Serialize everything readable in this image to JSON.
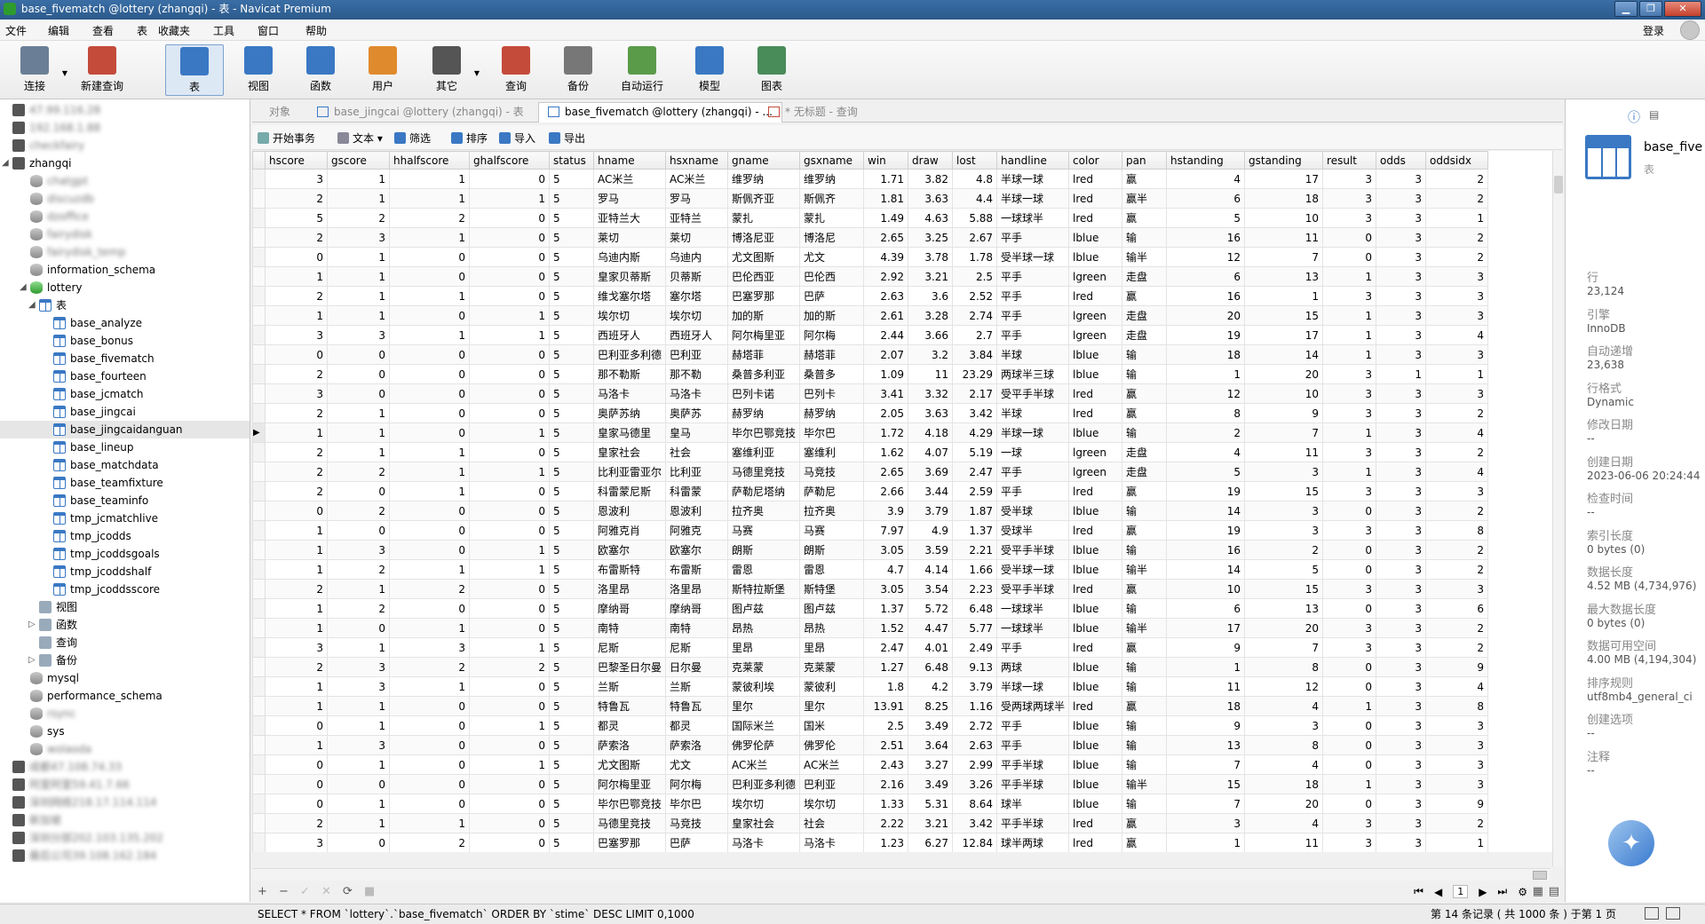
{
  "window": {
    "title": "base_fivematch @lottery (zhangqi) - 表 - Navicat Premium",
    "min": "▁",
    "max": "❐",
    "close": "✕"
  },
  "menu": [
    "文件",
    "编辑",
    "查看",
    "表",
    "收藏夹",
    "工具",
    "窗口",
    "帮助"
  ],
  "login": "登录",
  "toolbar": [
    {
      "label": "连接",
      "icon": "plug-icon",
      "color": "#6a7f95"
    },
    {
      "label": "新建查询",
      "icon": "new-query-icon",
      "color": "#c44b3a"
    },
    {
      "label": "表",
      "icon": "table-icon",
      "color": "#3a78c4"
    },
    {
      "label": "视图",
      "icon": "view-icon",
      "color": "#3a78c4"
    },
    {
      "label": "函数",
      "icon": "function-icon",
      "color": "#3a78c4"
    },
    {
      "label": "用户",
      "icon": "user-icon",
      "color": "#e08a2e"
    },
    {
      "label": "其它",
      "icon": "tools-icon",
      "color": "#555"
    },
    {
      "label": "查询",
      "icon": "query-icon",
      "color": "#c44b3a"
    },
    {
      "label": "备份",
      "icon": "backup-icon",
      "color": "#777"
    },
    {
      "label": "自动运行",
      "icon": "schedule-icon",
      "color": "#5a9b4a"
    },
    {
      "label": "模型",
      "icon": "model-icon",
      "color": "#3a78c4"
    },
    {
      "label": "图表",
      "icon": "chart-icon",
      "color": "#4a8b5a"
    }
  ],
  "tree": [
    {
      "label": "47.99.116.28",
      "icon": "conn",
      "blur": true
    },
    {
      "label": "192.168.1.88",
      "icon": "conn",
      "blur": true
    },
    {
      "label": "checkfairy",
      "icon": "conn",
      "blur": true
    },
    {
      "label": "zhangqi",
      "icon": "conn",
      "toggle": "◢"
    },
    {
      "label": "chatgpt",
      "icon": "db",
      "blur": true
    },
    {
      "label": "discuzdb",
      "icon": "db",
      "blur": true
    },
    {
      "label": "dzoffice",
      "icon": "db",
      "blur": true
    },
    {
      "label": "fairydisk",
      "icon": "db",
      "blur": true
    },
    {
      "label": "fairydisk_temp",
      "icon": "db",
      "blur": true
    },
    {
      "label": "information_schema",
      "icon": "db"
    },
    {
      "label": "lottery",
      "icon": "dbg",
      "toggle": "◢"
    },
    {
      "label": "表",
      "icon": "tbl",
      "toggle": "◢"
    },
    {
      "label": "base_analyze",
      "icon": "tbl"
    },
    {
      "label": "base_bonus",
      "icon": "tbl"
    },
    {
      "label": "base_fivematch",
      "icon": "tbl"
    },
    {
      "label": "base_fourteen",
      "icon": "tbl"
    },
    {
      "label": "base_jcmatch",
      "icon": "tbl"
    },
    {
      "label": "base_jingcai",
      "icon": "tbl"
    },
    {
      "label": "base_jingcaidanguan",
      "icon": "tbl",
      "selected": true
    },
    {
      "label": "base_lineup",
      "icon": "tbl"
    },
    {
      "label": "base_matchdata",
      "icon": "tbl"
    },
    {
      "label": "base_teamfixture",
      "icon": "tbl"
    },
    {
      "label": "base_teaminfo",
      "icon": "tbl"
    },
    {
      "label": "tmp_jcmatchlive",
      "icon": "tbl"
    },
    {
      "label": "tmp_jcodds",
      "icon": "tbl"
    },
    {
      "label": "tmp_jcoddsgoals",
      "icon": "tbl"
    },
    {
      "label": "tmp_jcoddshalf",
      "icon": "tbl"
    },
    {
      "label": "tmp_jcoddsscore",
      "icon": "tbl"
    },
    {
      "label": "视图",
      "icon": "misc"
    },
    {
      "label": "函数",
      "icon": "misc",
      "toggle": "▷"
    },
    {
      "label": "查询",
      "icon": "misc"
    },
    {
      "label": "备份",
      "icon": "misc",
      "toggle": "▷"
    },
    {
      "label": "mysql",
      "icon": "db"
    },
    {
      "label": "performance_schema",
      "icon": "db"
    },
    {
      "label": "rsync",
      "icon": "db",
      "blur": true
    },
    {
      "label": "sys",
      "icon": "db"
    },
    {
      "label": "wolaoda",
      "icon": "db",
      "blur": true
    },
    {
      "label": "成都47.108.74.33",
      "icon": "conn",
      "blur": true
    },
    {
      "label": "阿里阿里59.41.7.66",
      "icon": "conn",
      "blur": true
    },
    {
      "label": "深圳网络218.17.114.114",
      "icon": "conn",
      "blur": true
    },
    {
      "label": "新加坡",
      "icon": "conn",
      "blur": true
    },
    {
      "label": "深圳分部202.103.135.202",
      "icon": "conn",
      "blur": true
    },
    {
      "label": "最后公司39.108.162.184",
      "icon": "conn",
      "blur": true
    }
  ],
  "tabs": [
    {
      "label": "对象",
      "active": false
    },
    {
      "label": "base_jingcai @lottery (zhangqi) - 表",
      "active": false
    },
    {
      "label": "base_fivematch @lottery (zhangqi) - ...",
      "active": true
    },
    {
      "label": "* 无标题 - 查询",
      "active": false
    }
  ],
  "subtoolbar": [
    "开始事务",
    "文本",
    "筛选",
    "排序",
    "导入",
    "导出"
  ],
  "columns": [
    "hscore",
    "gscore",
    "hhalfscore",
    "ghalfscore",
    "status",
    "hname",
    "hsxname",
    "gname",
    "gsxname",
    "win",
    "draw",
    "lost",
    "handline",
    "color",
    "pan",
    "hstanding",
    "gstanding",
    "result",
    "odds",
    "oddsidx"
  ],
  "rows": [
    [
      "3",
      "1",
      "1",
      "0",
      "5",
      "AC米兰",
      "AC米兰",
      "维罗纳",
      "维罗纳",
      "1.71",
      "3.82",
      "4.8",
      "半球一球",
      "lred",
      "赢",
      "4",
      "17",
      "3",
      "3",
      "2"
    ],
    [
      "2",
      "1",
      "1",
      "1",
      "5",
      "罗马",
      "罗马",
      "斯佩齐亚",
      "斯佩齐",
      "1.81",
      "3.63",
      "4.4",
      "半球一球",
      "lred",
      "赢半",
      "6",
      "18",
      "3",
      "3",
      "2"
    ],
    [
      "5",
      "2",
      "2",
      "0",
      "5",
      "亚特兰大",
      "亚特兰",
      "蒙扎",
      "蒙扎",
      "1.49",
      "4.63",
      "5.88",
      "一球球半",
      "lred",
      "赢",
      "5",
      "10",
      "3",
      "3",
      "1"
    ],
    [
      "2",
      "3",
      "1",
      "0",
      "5",
      "莱切",
      "莱切",
      "博洛尼亚",
      "博洛尼",
      "2.65",
      "3.25",
      "2.67",
      "平手",
      "lblue",
      "输",
      "16",
      "11",
      "0",
      "3",
      "2"
    ],
    [
      "0",
      "1",
      "0",
      "0",
      "5",
      "乌迪内斯",
      "乌迪内",
      "尤文图斯",
      "尤文",
      "4.39",
      "3.78",
      "1.78",
      "受半球一球",
      "lblue",
      "输半",
      "12",
      "7",
      "0",
      "3",
      "2"
    ],
    [
      "1",
      "1",
      "0",
      "0",
      "5",
      "皇家贝蒂斯",
      "贝蒂斯",
      "巴伦西亚",
      "巴伦西",
      "2.92",
      "3.21",
      "2.5",
      "平手",
      "lgreen",
      "走盘",
      "6",
      "13",
      "1",
      "3",
      "3"
    ],
    [
      "2",
      "1",
      "1",
      "0",
      "5",
      "维戈塞尔塔",
      "塞尔塔",
      "巴塞罗那",
      "巴萨",
      "2.63",
      "3.6",
      "2.52",
      "平手",
      "lred",
      "赢",
      "16",
      "1",
      "3",
      "3",
      "3"
    ],
    [
      "1",
      "1",
      "0",
      "1",
      "5",
      "埃尔切",
      "埃尔切",
      "加的斯",
      "加的斯",
      "2.61",
      "3.28",
      "2.74",
      "平手",
      "lgreen",
      "走盘",
      "20",
      "15",
      "1",
      "3",
      "3"
    ],
    [
      "3",
      "3",
      "1",
      "1",
      "5",
      "西班牙人",
      "西班牙人",
      "阿尔梅里亚",
      "阿尔梅",
      "2.44",
      "3.66",
      "2.7",
      "平手",
      "lgreen",
      "走盘",
      "19",
      "17",
      "1",
      "3",
      "4"
    ],
    [
      "0",
      "0",
      "0",
      "0",
      "5",
      "巴利亚多利德",
      "巴利亚",
      "赫塔菲",
      "赫塔菲",
      "2.07",
      "3.2",
      "3.84",
      "半球",
      "lblue",
      "输",
      "18",
      "14",
      "1",
      "3",
      "3"
    ],
    [
      "2",
      "0",
      "0",
      "0",
      "5",
      "那不勒斯",
      "那不勒",
      "桑普多利亚",
      "桑普多",
      "1.09",
      "11",
      "23.29",
      "两球半三球",
      "lblue",
      "输",
      "1",
      "20",
      "3",
      "1",
      "1"
    ],
    [
      "3",
      "0",
      "0",
      "0",
      "5",
      "马洛卡",
      "马洛卡",
      "巴列卡诺",
      "巴列卡",
      "3.41",
      "3.32",
      "2.17",
      "受平手半球",
      "lred",
      "赢",
      "12",
      "10",
      "3",
      "3",
      "3"
    ],
    [
      "2",
      "1",
      "0",
      "0",
      "5",
      "奥萨苏纳",
      "奥萨苏",
      "赫罗纳",
      "赫罗纳",
      "2.05",
      "3.63",
      "3.42",
      "半球",
      "lred",
      "赢",
      "8",
      "9",
      "3",
      "3",
      "2"
    ],
    [
      "1",
      "1",
      "0",
      "1",
      "5",
      "皇家马德里",
      "皇马",
      "毕尔巴鄂竞技",
      "毕尔巴",
      "1.72",
      "4.18",
      "4.29",
      "半球一球",
      "lblue",
      "输",
      "2",
      "7",
      "1",
      "3",
      "4"
    ],
    [
      "2",
      "1",
      "1",
      "0",
      "5",
      "皇家社会",
      "社会",
      "塞维利亚",
      "塞维利",
      "1.62",
      "4.07",
      "5.19",
      "一球",
      "lgreen",
      "走盘",
      "4",
      "11",
      "3",
      "3",
      "2"
    ],
    [
      "2",
      "2",
      "1",
      "1",
      "5",
      "比利亚雷亚尔",
      "比利亚",
      "马德里竞技",
      "马竞技",
      "2.65",
      "3.69",
      "2.47",
      "平手",
      "lgreen",
      "走盘",
      "5",
      "3",
      "1",
      "3",
      "4"
    ],
    [
      "2",
      "0",
      "1",
      "0",
      "5",
      "科雷蒙尼斯",
      "科雷蒙",
      "萨勒尼塔纳",
      "萨勒尼",
      "2.66",
      "3.44",
      "2.59",
      "平手",
      "lred",
      "赢",
      "19",
      "15",
      "3",
      "3",
      "3"
    ],
    [
      "0",
      "2",
      "0",
      "0",
      "5",
      "恩波利",
      "恩波利",
      "拉齐奥",
      "拉齐奥",
      "3.9",
      "3.79",
      "1.87",
      "受半球",
      "lblue",
      "输",
      "14",
      "3",
      "0",
      "3",
      "2"
    ],
    [
      "1",
      "0",
      "0",
      "0",
      "5",
      "阿雅克肖",
      "阿雅克",
      "马赛",
      "马赛",
      "7.97",
      "4.9",
      "1.37",
      "受球半",
      "lred",
      "赢",
      "19",
      "3",
      "3",
      "3",
      "8"
    ],
    [
      "1",
      "3",
      "0",
      "1",
      "5",
      "欧塞尔",
      "欧塞尔",
      "朗斯",
      "朗斯",
      "3.05",
      "3.59",
      "2.21",
      "受平手半球",
      "lblue",
      "输",
      "16",
      "2",
      "0",
      "3",
      "2"
    ],
    [
      "1",
      "2",
      "1",
      "1",
      "5",
      "布雷斯特",
      "布雷斯",
      "雷恩",
      "雷恩",
      "4.7",
      "4.14",
      "1.66",
      "受半球一球",
      "lblue",
      "输半",
      "14",
      "5",
      "0",
      "3",
      "2"
    ],
    [
      "2",
      "1",
      "2",
      "0",
      "5",
      "洛里昂",
      "洛里昂",
      "斯特拉斯堡",
      "斯特堡",
      "3.05",
      "3.54",
      "2.23",
      "受平手半球",
      "lred",
      "赢",
      "10",
      "15",
      "3",
      "3",
      "3"
    ],
    [
      "1",
      "2",
      "0",
      "0",
      "5",
      "摩纳哥",
      "摩纳哥",
      "图卢兹",
      "图卢兹",
      "1.37",
      "5.72",
      "6.48",
      "一球球半",
      "lblue",
      "输",
      "6",
      "13",
      "0",
      "3",
      "6"
    ],
    [
      "1",
      "0",
      "1",
      "0",
      "5",
      "南特",
      "南特",
      "昂热",
      "昂热",
      "1.52",
      "4.47",
      "5.77",
      "一球球半",
      "lblue",
      "输半",
      "17",
      "20",
      "3",
      "3",
      "2"
    ],
    [
      "3",
      "1",
      "3",
      "1",
      "5",
      "尼斯",
      "尼斯",
      "里昂",
      "里昂",
      "2.47",
      "4.01",
      "2.49",
      "平手",
      "lred",
      "赢",
      "9",
      "7",
      "3",
      "3",
      "2"
    ],
    [
      "2",
      "3",
      "2",
      "2",
      "5",
      "巴黎圣日尔曼",
      "日尔曼",
      "克莱蒙",
      "克莱蒙",
      "1.27",
      "6.48",
      "9.13",
      "两球",
      "lblue",
      "输",
      "1",
      "8",
      "0",
      "3",
      "9"
    ],
    [
      "1",
      "3",
      "1",
      "0",
      "5",
      "兰斯",
      "兰斯",
      "蒙彼利埃",
      "蒙彼利",
      "1.8",
      "4.2",
      "3.79",
      "半球一球",
      "lblue",
      "输",
      "11",
      "12",
      "0",
      "3",
      "4"
    ],
    [
      "1",
      "1",
      "0",
      "0",
      "5",
      "特鲁瓦",
      "特鲁瓦",
      "里尔",
      "里尔",
      "13.91",
      "8.25",
      "1.16",
      "受两球两球半",
      "lred",
      "赢",
      "18",
      "4",
      "1",
      "3",
      "8"
    ],
    [
      "0",
      "1",
      "0",
      "1",
      "5",
      "都灵",
      "都灵",
      "国际米兰",
      "国米",
      "2.5",
      "3.49",
      "2.72",
      "平手",
      "lblue",
      "输",
      "9",
      "3",
      "0",
      "3",
      "3"
    ],
    [
      "1",
      "3",
      "0",
      "0",
      "5",
      "萨索洛",
      "萨索洛",
      "佛罗伦萨",
      "佛罗伦",
      "2.51",
      "3.64",
      "2.63",
      "平手",
      "lblue",
      "输",
      "13",
      "8",
      "0",
      "3",
      "3"
    ],
    [
      "0",
      "1",
      "0",
      "1",
      "5",
      "尤文图斯",
      "尤文",
      "AC米兰",
      "AC米兰",
      "2.43",
      "3.27",
      "2.99",
      "平手半球",
      "lblue",
      "输",
      "7",
      "4",
      "0",
      "3",
      "3"
    ],
    [
      "0",
      "0",
      "0",
      "0",
      "5",
      "阿尔梅里亚",
      "阿尔梅",
      "巴利亚多利德",
      "巴利亚",
      "2.16",
      "3.49",
      "3.26",
      "平手半球",
      "lblue",
      "输半",
      "15",
      "18",
      "1",
      "3",
      "3"
    ],
    [
      "0",
      "1",
      "0",
      "0",
      "5",
      "毕尔巴鄂竞技",
      "毕尔巴",
      "埃尔切",
      "埃尔切",
      "1.33",
      "5.31",
      "8.64",
      "球半",
      "lblue",
      "输",
      "7",
      "20",
      "0",
      "3",
      "9"
    ],
    [
      "2",
      "1",
      "1",
      "0",
      "5",
      "马德里竞技",
      "马竞技",
      "皇家社会",
      "社会",
      "2.22",
      "3.21",
      "3.42",
      "平手半球",
      "lred",
      "赢",
      "3",
      "4",
      "3",
      "3",
      "2"
    ],
    [
      "3",
      "0",
      "2",
      "0",
      "5",
      "巴塞罗那",
      "巴萨",
      "马洛卡",
      "马洛卡",
      "1.23",
      "6.27",
      "12.84",
      "球半两球",
      "lred",
      "赢",
      "1",
      "11",
      "3",
      "3",
      "1"
    ]
  ],
  "bottom": {
    "add": "+",
    "remove": "−",
    "apply": "✓",
    "cancel": "✕",
    "refresh": "⟳",
    "stop": "■",
    "page": "1"
  },
  "status": {
    "sql": "SELECT * FROM `lottery`.`base_fivematch` ORDER BY `stime` DESC LIMIT 0,1000",
    "records": "第 14 条记录 ( 共 1000 条 ) 于第 1 页"
  },
  "info": {
    "name": "base_five",
    "type": "表",
    "fields": [
      {
        "label": "行",
        "value": "23,124"
      },
      {
        "label": "引擎",
        "value": "InnoDB"
      },
      {
        "label": "自动递增",
        "value": "23,638"
      },
      {
        "label": "行格式",
        "value": "Dynamic"
      },
      {
        "label": "修改日期",
        "value": "--"
      },
      {
        "label": "创建日期",
        "value": "2023-06-06 20:24:44"
      },
      {
        "label": "检查时间",
        "value": "--"
      },
      {
        "label": "索引长度",
        "value": "0 bytes (0)"
      },
      {
        "label": "数据长度",
        "value": "4.52 MB (4,734,976)"
      },
      {
        "label": "最大数据长度",
        "value": "0 bytes (0)"
      },
      {
        "label": "数据可用空间",
        "value": "4.00 MB (4,194,304)"
      },
      {
        "label": "排序规则",
        "value": "utf8mb4_general_ci"
      },
      {
        "label": "创建选项",
        "value": "--"
      },
      {
        "label": "注释",
        "value": "--"
      }
    ]
  }
}
